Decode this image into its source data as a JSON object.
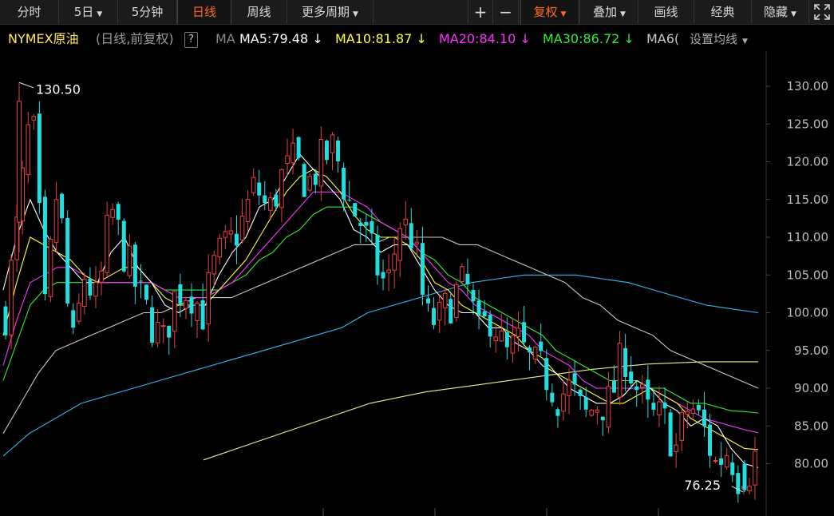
{
  "toolbar": {
    "items": [
      {
        "label": "分时",
        "active": false,
        "dropdown": false
      },
      {
        "label": "5日",
        "active": false,
        "dropdown": true
      },
      {
        "label": "5分钟",
        "active": false,
        "dropdown": false
      },
      {
        "label": "日线",
        "active": true,
        "dropdown": false
      },
      {
        "label": "周线",
        "active": false,
        "dropdown": false
      },
      {
        "label": "更多周期",
        "active": false,
        "dropdown": true
      }
    ],
    "zoom_in": "+",
    "zoom_out": "−",
    "fuquan": "复权",
    "overlay": "叠加",
    "draw": "画线",
    "classic": "经典",
    "hide": "隐藏",
    "expand_icon": "expand-icon"
  },
  "info": {
    "symbol": "NYMEX原油",
    "mode": "(日线,前复权)",
    "help": "?",
    "ma_label": "MA",
    "ma5": "MA5:79.48",
    "ma10": "MA10:81.87",
    "ma20": "MA20:84.10",
    "ma30": "MA30:86.72",
    "ma60": "MA6(",
    "settings": "设置均线",
    "colors": {
      "ma5": "#ffffff",
      "ma10": "#ffff33",
      "ma20": "#ff33ff",
      "ma30": "#33ee33",
      "ma60": "#c8c8c8",
      "ma120": "#33bbee",
      "ma250": "#eeee88",
      "up": "#e84040",
      "down": "#22dede"
    }
  },
  "chart_data": {
    "type": "candlestick",
    "y_ticks": [
      "130.00",
      "125.00",
      "120.00",
      "115.00",
      "110.00",
      "105.00",
      "100.00",
      "95.00",
      "90.00",
      "85.00",
      "80.00"
    ],
    "ylim": [
      75,
      133
    ],
    "high_annotation": "130.50",
    "low_annotation": "76.25",
    "close_path": [
      100,
      113,
      128,
      100,
      118,
      94,
      105,
      101,
      114,
      108,
      103,
      99,
      96,
      103,
      103,
      100,
      107,
      109,
      112,
      117,
      113,
      118,
      120,
      117,
      120,
      122,
      115,
      112,
      107,
      103,
      112,
      110,
      99,
      99,
      102,
      104,
      97,
      100,
      94,
      96,
      93,
      92,
      89,
      90,
      86,
      88,
      88,
      95,
      90,
      86,
      86,
      82,
      88,
      85,
      80,
      82,
      77,
      81
    ],
    "ma5_path": [
      103,
      110,
      115,
      111,
      108,
      106,
      104,
      104,
      108,
      110,
      106,
      104,
      101,
      100,
      101,
      101,
      105,
      108,
      110,
      114,
      115,
      118,
      121,
      119,
      117,
      115,
      111,
      110,
      108,
      109,
      109,
      106,
      103,
      101,
      100,
      100,
      98,
      98,
      96,
      95,
      93,
      92,
      90,
      89,
      88,
      88,
      89,
      91,
      90,
      88,
      87,
      85,
      86,
      85,
      82,
      80,
      79.48
    ],
    "ma10_path": [
      97,
      104,
      110,
      109,
      108,
      107,
      105,
      104,
      105,
      106,
      106,
      104,
      102,
      101,
      101,
      101,
      103,
      105,
      107,
      110,
      113,
      116,
      118,
      119,
      118,
      116,
      113,
      111,
      110,
      110,
      109,
      107,
      104,
      103,
      101,
      100,
      99,
      98,
      97,
      95,
      94,
      92,
      91,
      90,
      89,
      88,
      88,
      89,
      90,
      89,
      88,
      86,
      85,
      84,
      83,
      82,
      81.87
    ],
    "ma20_path": [
      93,
      99,
      104,
      105,
      106,
      106,
      105,
      104,
      104,
      104,
      104,
      104,
      103,
      102,
      102,
      102,
      103,
      104,
      106,
      108,
      110,
      112,
      114,
      116,
      116,
      116,
      115,
      114,
      112,
      111,
      110,
      108,
      106,
      104,
      103,
      101,
      100,
      99,
      98,
      97,
      95,
      94,
      93,
      91,
      90,
      90,
      90,
      90,
      90,
      89,
      88,
      87,
      86,
      85.5,
      85,
      84.5,
      84.1
    ],
    "ma30_path": [
      91,
      96,
      101,
      103,
      104,
      104,
      104,
      104,
      104,
      104,
      104,
      104,
      103,
      103,
      103,
      103,
      103,
      104,
      105,
      107,
      108,
      110,
      111,
      113,
      114,
      114,
      114,
      113,
      112,
      111,
      110,
      108,
      107,
      105,
      104,
      102,
      101,
      100,
      99,
      98,
      97,
      95,
      94,
      93,
      92,
      91,
      91,
      91,
      90,
      90,
      89,
      88,
      88,
      87.5,
      87,
      86.9,
      86.72
    ],
    "ma60_path": [
      84,
      88,
      92,
      95,
      96,
      97,
      98,
      99,
      100,
      100,
      101,
      102,
      102,
      102,
      103,
      104,
      105,
      106,
      107,
      108,
      109,
      109,
      110,
      110,
      110,
      110,
      109,
      109,
      108,
      107,
      106,
      105,
      104,
      102,
      101,
      99,
      98,
      97,
      95,
      94,
      93,
      92,
      91,
      90
    ],
    "ma120_path": [
      81,
      84,
      86,
      88,
      89,
      90,
      91,
      92,
      93,
      94,
      95,
      96,
      97,
      98,
      100,
      101,
      102,
      103,
      104,
      104.5,
      105,
      105,
      105,
      104.5,
      104,
      103,
      102,
      101,
      100.5,
      100
    ],
    "ma250_path": [
      80.5,
      83,
      85.5,
      88,
      89.5,
      90.5,
      91.5,
      92.5,
      93.2,
      93.5,
      93.5
    ]
  }
}
